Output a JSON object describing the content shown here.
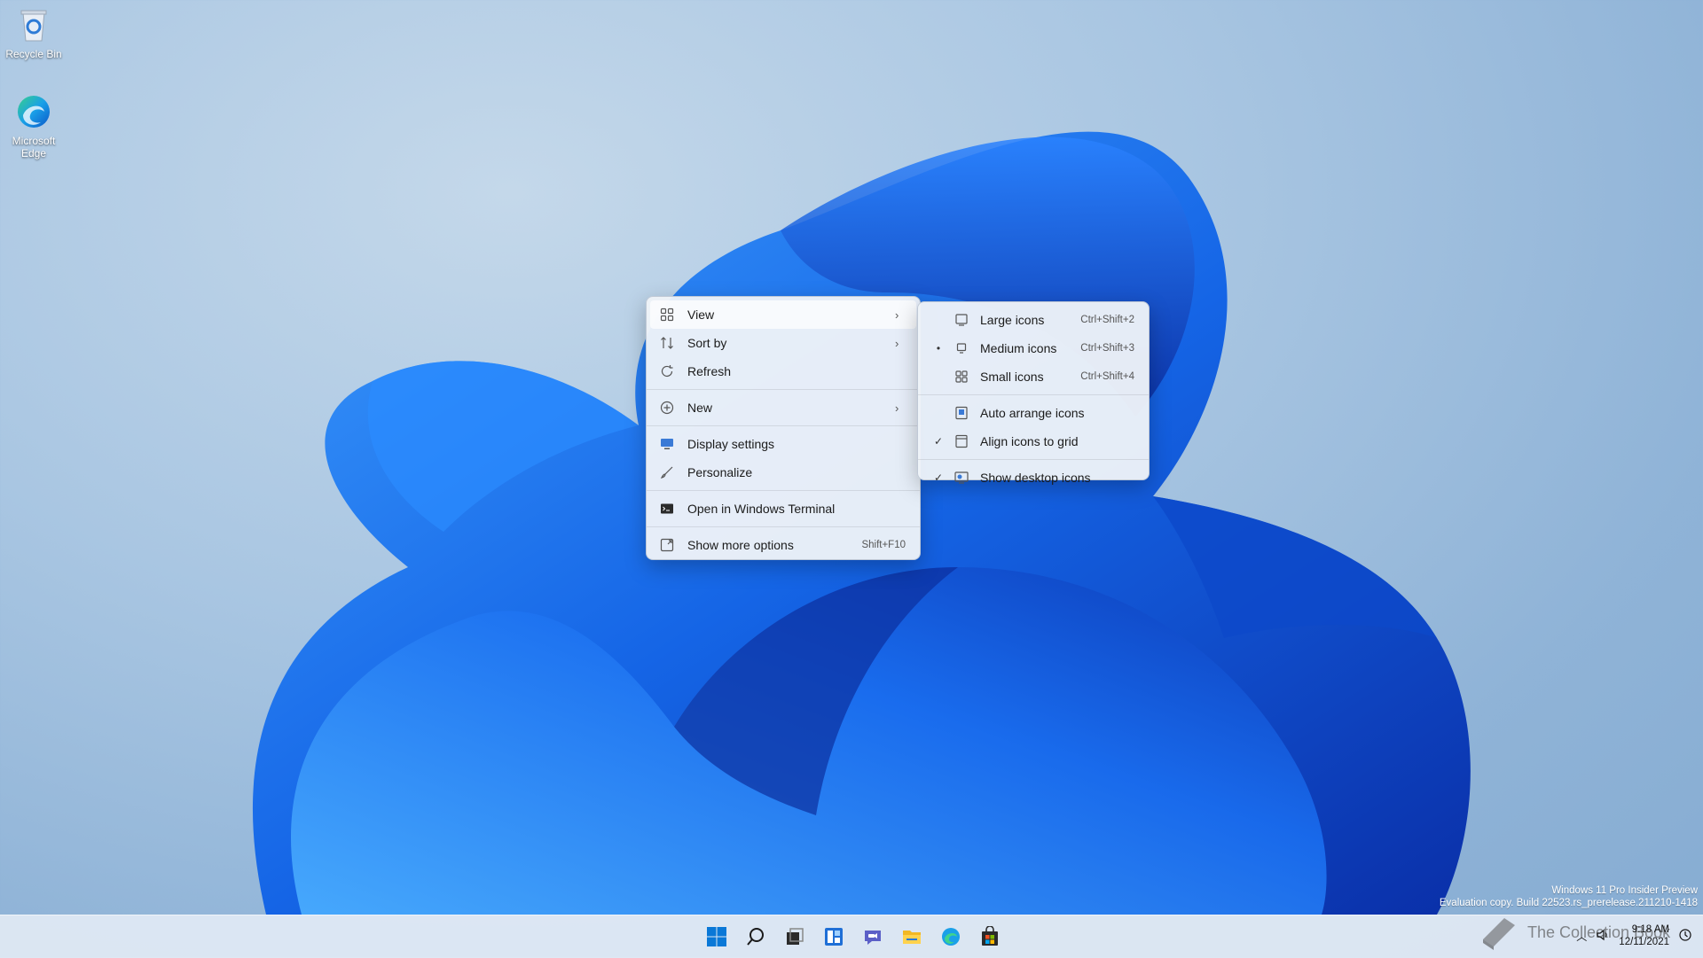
{
  "desktop": {
    "icons": [
      {
        "label": "Recycle Bin"
      },
      {
        "label": "Microsoft Edge"
      }
    ]
  },
  "context_menu": {
    "items": [
      {
        "label": "View",
        "icon": "view-grid-icon",
        "has_submenu": true
      },
      {
        "label": "Sort by",
        "icon": "sort-icon",
        "has_submenu": true
      },
      {
        "label": "Refresh",
        "icon": "refresh-icon"
      },
      {
        "label": "New",
        "icon": "new-plus-icon",
        "has_submenu": true
      },
      {
        "label": "Display settings",
        "icon": "display-icon"
      },
      {
        "label": "Personalize",
        "icon": "brush-icon"
      },
      {
        "label": "Open in Windows Terminal",
        "icon": "terminal-icon"
      },
      {
        "label": "Show more options",
        "icon": "more-options-icon",
        "shortcut": "Shift+F10"
      }
    ]
  },
  "view_submenu": {
    "items": [
      {
        "label": "Large icons",
        "shortcut": "Ctrl+Shift+2",
        "selected": false
      },
      {
        "label": "Medium icons",
        "shortcut": "Ctrl+Shift+3",
        "selected": true
      },
      {
        "label": "Small icons",
        "shortcut": "Ctrl+Shift+4",
        "selected": false
      },
      {
        "label": "Auto arrange icons",
        "checked": false
      },
      {
        "label": "Align icons to grid",
        "checked": true
      },
      {
        "label": "Show desktop icons",
        "checked": true
      }
    ],
    "bullet": "•",
    "check": "✓"
  },
  "taskbar": {
    "apps": [
      "start-icon",
      "search-icon",
      "task-view-icon",
      "widgets-icon",
      "chat-icon",
      "file-explorer-icon",
      "edge-icon",
      "store-icon"
    ]
  },
  "watermark": {
    "line1": "Windows 11 Pro Insider Preview",
    "line2": "Evaluation copy. Build 22523.rs_prerelease.211210-1418"
  },
  "brand_overlay": "The Collection Book",
  "clock": {
    "time": "9:18 AM",
    "date": "12/11/2021"
  },
  "colors": {
    "accent": "#0067c0",
    "menu_bg": "#eef2f8"
  }
}
